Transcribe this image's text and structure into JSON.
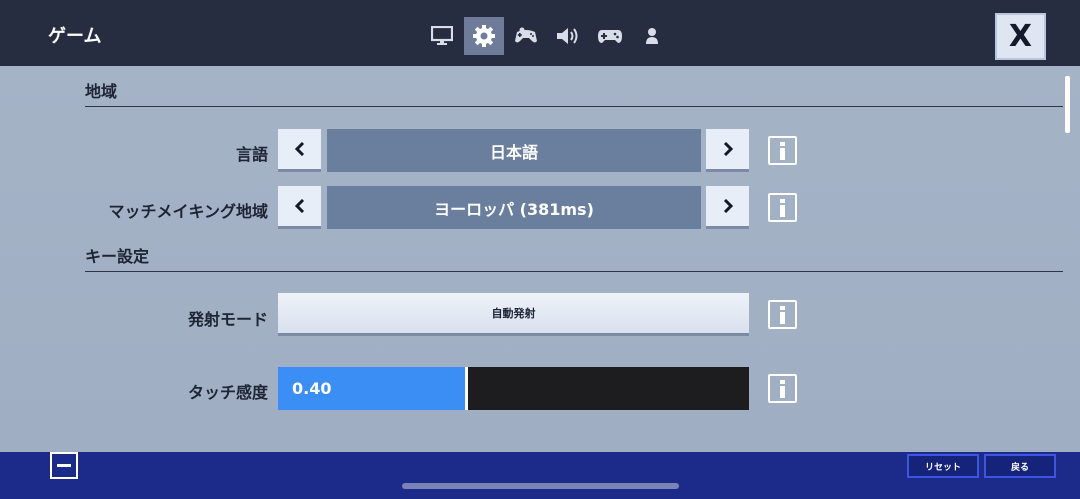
{
  "header": {
    "title": "ゲーム",
    "tabs": [
      {
        "icon": "monitor-icon",
        "active": false
      },
      {
        "icon": "gear-icon",
        "active": true
      },
      {
        "icon": "controller-alt-icon",
        "active": false
      },
      {
        "icon": "speaker-icon",
        "active": false
      },
      {
        "icon": "gamepad-icon",
        "active": false
      },
      {
        "icon": "person-icon",
        "active": false
      }
    ],
    "close_label": "X"
  },
  "sections": {
    "region": {
      "heading": "地域",
      "language": {
        "label": "言語",
        "value": "日本語"
      },
      "matchmaking": {
        "label": "マッチメイキング地域",
        "value": "ヨーロッパ (381ms)"
      }
    },
    "keys": {
      "heading": "キー設定",
      "fire_mode": {
        "label": "発射モード",
        "value": "自動発射"
      },
      "touch_sensitivity": {
        "label": "タッチ感度",
        "value": "0.40",
        "fraction": 0.4
      }
    }
  },
  "footer": {
    "reset_label": "リセット",
    "back_label": "戻る"
  },
  "colors": {
    "accent": "#3b8ef3",
    "topbar": "#262d40",
    "bottombar": "#1c2a8a"
  }
}
